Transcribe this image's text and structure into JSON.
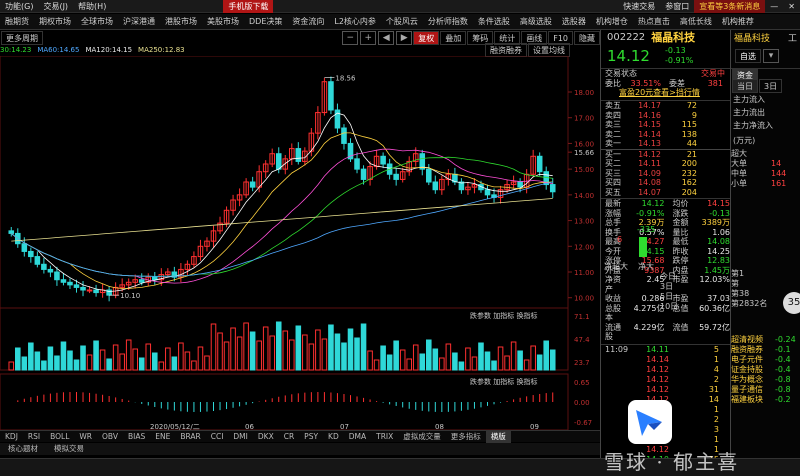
{
  "menu": {
    "items": [
      "功能(G)",
      "交易(J)",
      "帮助(H)"
    ],
    "right": [
      "快速交易",
      "参窗口"
    ],
    "promo_button": "手机版下载",
    "promo_right": "宣看等3条新消息"
  },
  "nav": {
    "items": [
      "融期货",
      "期权市场",
      "全球市场",
      "沪深港通",
      "港股市场",
      "美股市场",
      "DDE决策",
      "资金流向",
      "L2核心内参",
      "个股风云",
      "分析师指数",
      "条件选股",
      "高级选股",
      "选股器",
      "机构增仓",
      "热点直击",
      "高低长线",
      "机构推荐"
    ]
  },
  "toolbar": {
    "period_label": "更多周期",
    "fuquan": "复权",
    "overlay": "叠加",
    "chips": "筹码",
    "stats": "统计",
    "draw": "画线",
    "f10": "F10",
    "hide": "隐藏",
    "financing": "融资融券",
    "settings": "设置均线"
  },
  "ma_line": {
    "ma30": "30:14.23",
    "ma60": "MA60:14.65",
    "ma120": "MA120:14.15",
    "ma250": "MA250:12.83"
  },
  "chart_data": [
    {
      "type": "candlestick",
      "title": "",
      "y_ticks": [
        18.0,
        17.0,
        16.0,
        15.66,
        15.0,
        14.0,
        13.0,
        12.0,
        11.0,
        10.0
      ],
      "ylim": [
        9.6,
        19.4
      ],
      "annotations": [
        {
          "label": "18.56",
          "value": 18.56
        },
        {
          "label": "10.10",
          "value": 10.1
        }
      ],
      "x_labels": [
        "2020/05/12/二",
        "06",
        "07",
        "08",
        "09",
        "10"
      ],
      "x_labels_top": [
        "04",
        "05",
        "06",
        "07",
        "08",
        "09",
        "10"
      ],
      "closes": [
        12.5,
        12.1,
        11.8,
        11.6,
        11.3,
        11.1,
        11.0,
        10.7,
        10.6,
        10.5,
        10.4,
        10.3,
        10.3,
        10.2,
        10.3,
        10.1,
        10.4,
        10.5,
        10.6,
        10.7,
        10.6,
        10.8,
        10.7,
        10.9,
        11.0,
        10.8,
        11.1,
        11.3,
        11.6,
        12.0,
        12.2,
        12.6,
        12.9,
        13.4,
        13.8,
        14.0,
        14.5,
        14.3,
        14.9,
        15.2,
        15.6,
        15.0,
        15.4,
        15.8,
        15.3,
        15.7,
        16.4,
        17.2,
        18.4,
        17.3,
        16.6,
        16.0,
        15.4,
        15.0,
        14.6,
        15.1,
        15.5,
        15.2,
        14.8,
        14.6,
        14.9,
        15.3,
        15.6,
        15.0,
        14.5,
        14.2,
        14.6,
        14.8,
        14.5,
        14.2,
        14.3,
        14.4,
        14.2,
        14.0,
        13.9,
        14.2,
        14.4,
        14.5,
        14.3,
        14.8,
        15.5,
        14.9,
        14.4,
        14.12
      ]
    },
    {
      "type": "bar",
      "title": "",
      "y_ticks": [
        71.1,
        47.4,
        23.7
      ],
      "tabs": [
        "跌参数",
        "加指标",
        "换指标"
      ]
    },
    {
      "type": "bar",
      "title": "",
      "y_ticks": [
        0.65,
        0.0,
        -0.67
      ],
      "tabs": [
        "跌参数",
        "加指标",
        "换指标"
      ]
    }
  ],
  "stock": {
    "code": "002222",
    "name": "福晶科技",
    "price": "14.12",
    "change": "-0.13",
    "pct": "-0.91%",
    "badge": "自选",
    "state_label": "交易状态",
    "state_value": "交易中",
    "webi_label": "委比",
    "webi_value": "33.51%",
    "weicha_label": "委差",
    "weicha_value": "381",
    "promo": "富盈20元查看>挡行情"
  },
  "asks": [
    {
      "label": "卖五",
      "price": "14.17",
      "vol": "72"
    },
    {
      "label": "卖四",
      "price": "14.16",
      "vol": "9"
    },
    {
      "label": "卖三",
      "price": "14.15",
      "vol": "115"
    },
    {
      "label": "卖二",
      "price": "14.14",
      "vol": "138"
    },
    {
      "label": "卖一",
      "price": "14.13",
      "vol": "44"
    }
  ],
  "bids": [
    {
      "label": "买一",
      "price": "14.12",
      "vol": "21"
    },
    {
      "label": "买二",
      "price": "14.11",
      "vol": "200"
    },
    {
      "label": "买三",
      "price": "14.09",
      "vol": "232"
    },
    {
      "label": "买四",
      "price": "14.08",
      "vol": "162"
    },
    {
      "label": "买五",
      "price": "14.07",
      "vol": "204"
    }
  ],
  "stats": [
    {
      "l": "最新",
      "v": "14.12",
      "l2": "均价",
      "v2": "14.15",
      "c1": "grn",
      "c2": "red"
    },
    {
      "l": "涨幅",
      "v": "-0.91%",
      "l2": "涨跌",
      "v2": "-0.13",
      "c1": "grn",
      "c2": "grn"
    },
    {
      "l": "总手",
      "v": "2.39万",
      "l2": "金额",
      "v2": "3389万",
      "c1": "yel",
      "c2": "yel"
    },
    {
      "l": "换手",
      "v": "0.57%",
      "l2": "量比",
      "v2": "1.06",
      "c1": "wht",
      "c2": "wht"
    },
    {
      "l": "最高",
      "v": "14.27",
      "l2": "最低",
      "v2": "14.08",
      "c1": "red",
      "c2": "grn"
    },
    {
      "l": "今开",
      "v": "14.15",
      "l2": "昨收",
      "v2": "14.25",
      "c1": "grn",
      "c2": "wht"
    },
    {
      "l": "涨停",
      "v": "15.68",
      "l2": "跌停",
      "v2": "12.83",
      "c1": "red",
      "c2": "grn"
    },
    {
      "l": "外盘",
      "v": "9387",
      "l2": "内盘",
      "v2": "1.45万",
      "c1": "red",
      "c2": "grn"
    },
    {
      "l": "净资产",
      "v": "2.45",
      "l2": "市盈",
      "v2": "12.03%",
      "c1": "wht",
      "c2": "wht"
    },
    {
      "l": "收益",
      "v": "0.286",
      "l2": "市盈",
      "v2": "37.03",
      "c1": "wht",
      "c2": "wht"
    },
    {
      "l": "总股本",
      "v": "4.275亿",
      "l2": "总值",
      "v2": "60.36亿",
      "c1": "wht",
      "c2": "wht"
    },
    {
      "l": "流通股",
      "v": "4.229亿",
      "l2": "流值",
      "v2": "59.72亿",
      "c1": "wht",
      "c2": "wht"
    }
  ],
  "ticks": [
    {
      "t": "11:09",
      "p": "14.11",
      "n": "5"
    },
    {
      "t": "",
      "p": "14.14",
      "n": "1"
    },
    {
      "t": "",
      "p": "14.12",
      "n": "4"
    },
    {
      "t": "",
      "p": "14.12",
      "n": "2"
    },
    {
      "t": "",
      "p": "14.12",
      "n": "31"
    },
    {
      "t": "",
      "p": "14.12",
      "n": "14"
    },
    {
      "t": "",
      "p": "14.12",
      "n": "1"
    },
    {
      "t": "",
      "p": "14.12",
      "n": "2"
    },
    {
      "t": "",
      "p": "14.13",
      "n": "3"
    },
    {
      "t": "",
      "p": "14.10",
      "n": "1"
    },
    {
      "t": "",
      "p": "14.12",
      "n": "1"
    },
    {
      "t": "",
      "p": "14.10",
      "n": "15"
    }
  ],
  "right2": {
    "tabs": [
      "资金",
      "当日",
      "3日"
    ],
    "flow": [
      "主力流入",
      "主力流出",
      "主力净流入"
    ],
    "unit": "(万元)",
    "sizes": [
      {
        "l": "超大",
        "v": ""
      },
      {
        "l": "大单",
        "v": "14"
      },
      {
        "l": "中单",
        "v": "144"
      },
      {
        "l": "小单",
        "v": "161"
      }
    ],
    "bars_label": [
      "净超大",
      "净大"
    ],
    "bar_values": [
      "6",
      "-335"
    ],
    "days": [
      "今日",
      "3日",
      "5日",
      "10日"
    ],
    "days_right": [
      "第1",
      "第",
      "第38",
      "第2832名"
    ],
    "percent": "35",
    "concepts": [
      {
        "name": "超清视频",
        "val": "-0.24"
      },
      {
        "name": "融资融券",
        "val": "-0.1"
      },
      {
        "name": "电子元件",
        "val": "-0.4"
      },
      {
        "name": "证金持股",
        "val": "-0.4"
      },
      {
        "name": "华为概念",
        "val": "-0.8"
      },
      {
        "name": "量子通信",
        "val": "-0.8"
      },
      {
        "name": "福建板块",
        "val": "-0.2"
      }
    ],
    "brand_short": "工"
  },
  "bottom_tabs": [
    "KDJ",
    "RSI",
    "BOLL",
    "WR",
    "OBV",
    "BIAS",
    "ENE",
    "BRAR",
    "CCI",
    "DMI",
    "DKX",
    "CR",
    "PSY",
    "KD",
    "DMA",
    "TRIX",
    "虚拟成交量",
    "更多指标",
    "横版"
  ],
  "bottom2": [
    "核心题材",
    "模拟交易"
  ],
  "watermark": "雪球 · 郁主喜",
  "colors": {
    "up": "#ff3030",
    "down": "#2fd8d8",
    "ma5": "#ffffff",
    "ma10": "#ffd23f",
    "ma20": "#ff4fd8",
    "ma30": "#2fdc2f",
    "ma60": "#4fa8ff",
    "ma250": "#e8e090"
  }
}
